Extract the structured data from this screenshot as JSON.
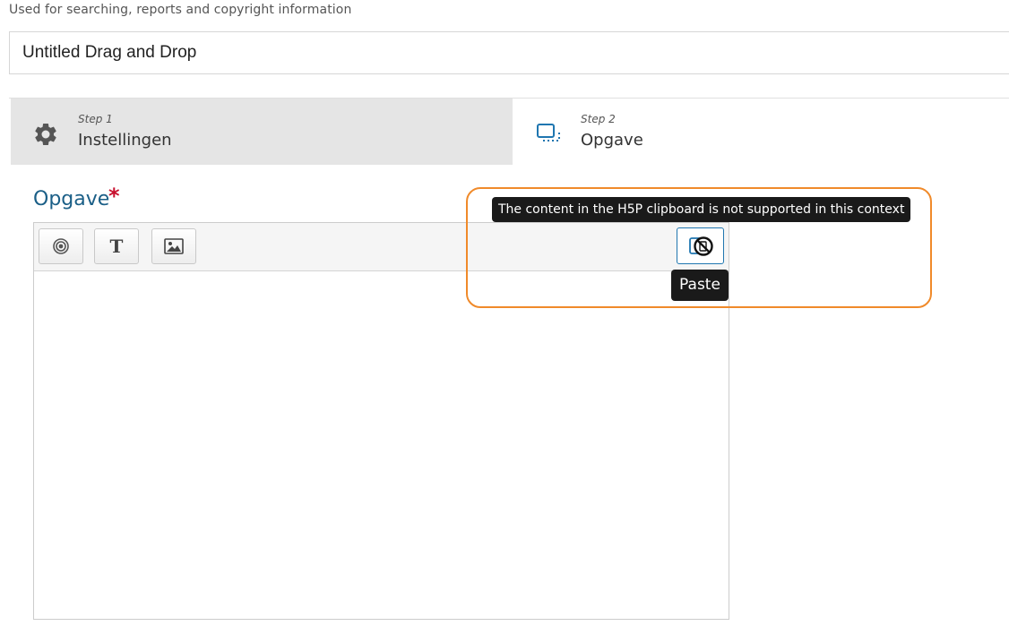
{
  "header": {
    "description": "Used for searching, reports and copyright information",
    "title_value": "Untitled Drag and Drop"
  },
  "steps": [
    {
      "small": "Step 1",
      "label": "Instellingen",
      "icon": "gear-icon"
    },
    {
      "small": "Step 2",
      "label": "Opgave",
      "icon": "dashed-frame-icon"
    }
  ],
  "field": {
    "label": "Opgave",
    "required_mark": "*"
  },
  "toolbar": {
    "buttons": [
      {
        "icon": "target-icon"
      },
      {
        "icon": "text-icon",
        "glyph": "T"
      },
      {
        "icon": "image-icon"
      }
    ],
    "paste_icon": "paste-disabled-icon"
  },
  "tooltips": {
    "clipboard_message": "The content in the H5P clipboard is not supported in this context",
    "paste_label": "Paste"
  },
  "colors": {
    "accent": "#1b5f87",
    "required": "#c8102e",
    "highlight": "#f08a2a",
    "paste_border": "#1f76b0"
  }
}
